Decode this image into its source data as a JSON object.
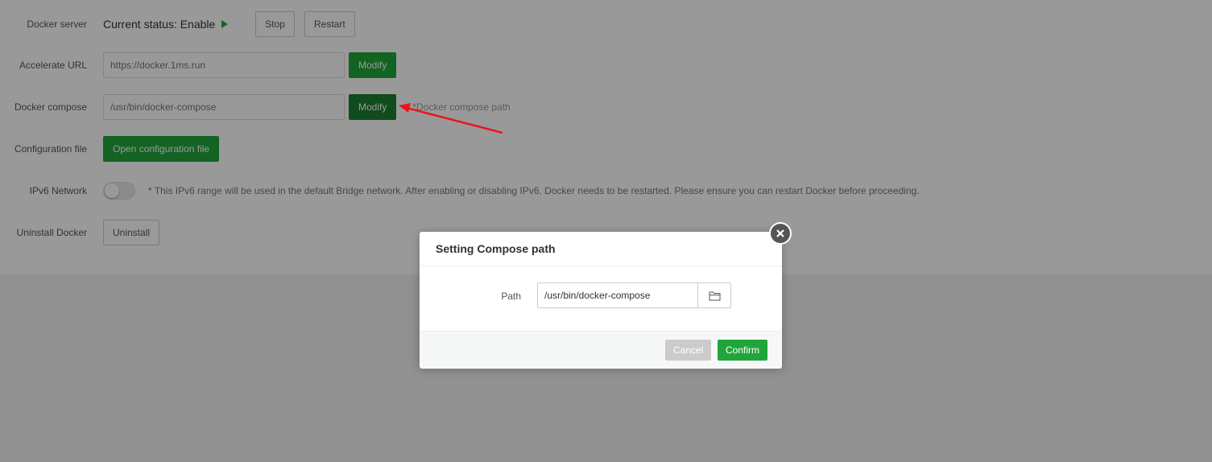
{
  "settings": {
    "docker_server": {
      "label": "Docker server",
      "status_text": "Current status: Enable",
      "stop_label": "Stop",
      "restart_label": "Restart"
    },
    "accelerate_url": {
      "label": "Accelerate URL",
      "placeholder": "https://docker.1ms.run",
      "modify_label": "Modify"
    },
    "docker_compose": {
      "label": "Docker compose",
      "placeholder": "/usr/bin/docker-compose",
      "modify_label": "Modify",
      "hint": "*Docker compose path"
    },
    "configuration_file": {
      "label": "Configuration file",
      "button_label": "Open configuration file"
    },
    "ipv6_network": {
      "label": "IPv6 Network",
      "enabled": false,
      "note": "* This IPv6 range will be used in the default Bridge network. After enabling or disabling IPv6, Docker needs to be restarted. Please ensure you can restart Docker before proceeding."
    },
    "uninstall_docker": {
      "label": "Uninstall Docker",
      "button_label": "Uninstall"
    }
  },
  "dialog": {
    "title": "Setting Compose path",
    "path_label": "Path",
    "path_value": "/usr/bin/docker-compose",
    "cancel_label": "Cancel",
    "confirm_label": "Confirm"
  },
  "colors": {
    "accent_green": "#20a53a",
    "annotation_arrow": "#e8171e"
  }
}
